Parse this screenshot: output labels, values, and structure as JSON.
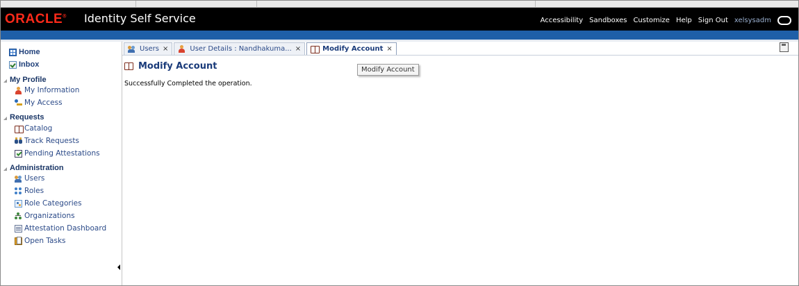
{
  "header": {
    "logo_text": "ORACLE",
    "app_title": "Identity Self Service",
    "links": [
      "Accessibility",
      "Sandboxes",
      "Customize",
      "Help",
      "Sign Out"
    ],
    "username": "xelsysadm"
  },
  "sidebar": {
    "home": "Home",
    "inbox": "Inbox",
    "sections": [
      {
        "title": "My Profile",
        "items": [
          "My Information",
          "My Access"
        ]
      },
      {
        "title": "Requests",
        "items": [
          "Catalog",
          "Track Requests",
          "Pending Attestations"
        ]
      },
      {
        "title": "Administration",
        "items": [
          "Users",
          "Roles",
          "Role Categories",
          "Organizations",
          "Attestation Dashboard",
          "Open Tasks"
        ]
      }
    ]
  },
  "tabs": [
    {
      "label": "Users",
      "close": "×"
    },
    {
      "label": "User Details : Nandhakuma...",
      "close": "×"
    },
    {
      "label": "Modify Account",
      "close": "×"
    }
  ],
  "main": {
    "page_title": "Modify Account",
    "message": "Successfully Completed the operation.",
    "tooltip": "Modify Account"
  },
  "colors": {
    "header_bg": "#000000",
    "brand_red": "#ff2a1a",
    "blue_bar": "#1e5fa8",
    "link_blue": "#2b4a88"
  }
}
